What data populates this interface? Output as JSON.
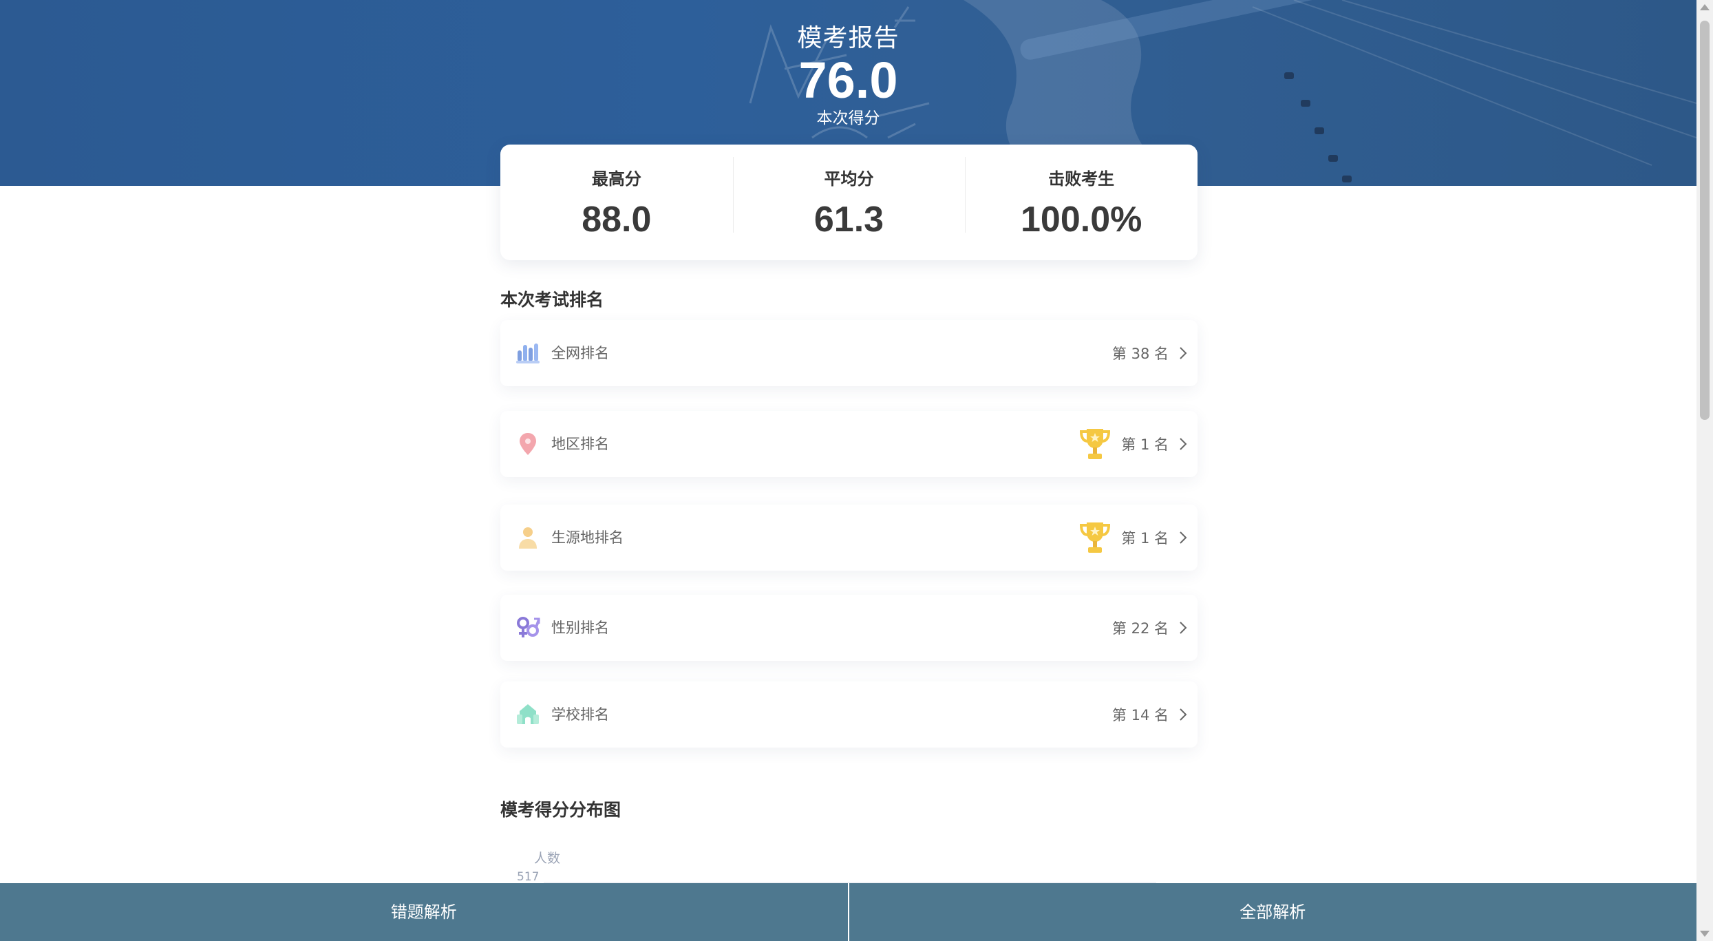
{
  "header": {
    "title": "模考报告",
    "score": "76.0",
    "score_caption": "本次得分"
  },
  "stats": [
    {
      "label": "最高分",
      "value": "88.0"
    },
    {
      "label": "平均分",
      "value": "61.3"
    },
    {
      "label": "击败考生",
      "value": "100.0%"
    }
  ],
  "ranking": {
    "title": "本次考试排名",
    "items": [
      {
        "label": "全网排名",
        "value": "第 38 名",
        "icon": "bar-chart-icon",
        "trophy": false
      },
      {
        "label": "地区排名",
        "value": "第 1 名",
        "icon": "map-pin-icon",
        "trophy": true
      },
      {
        "label": "生源地排名",
        "value": "第 1 名",
        "icon": "person-icon",
        "trophy": true
      },
      {
        "label": "性别排名",
        "value": "第 22 名",
        "icon": "gender-icon",
        "trophy": false
      },
      {
        "label": "学校排名",
        "value": "第 14 名",
        "icon": "school-icon",
        "trophy": false
      }
    ]
  },
  "distribution": {
    "title": "模考得分分布图",
    "y_axis_label": "人数",
    "y_top_tick": "517"
  },
  "footer": {
    "wrong_analysis": "错题解析",
    "all_analysis": "全部解析"
  },
  "colors": {
    "header_blue": "#2d5f9a",
    "footer_bar": "#4e788f",
    "trophy_gold": "#f5c842"
  }
}
